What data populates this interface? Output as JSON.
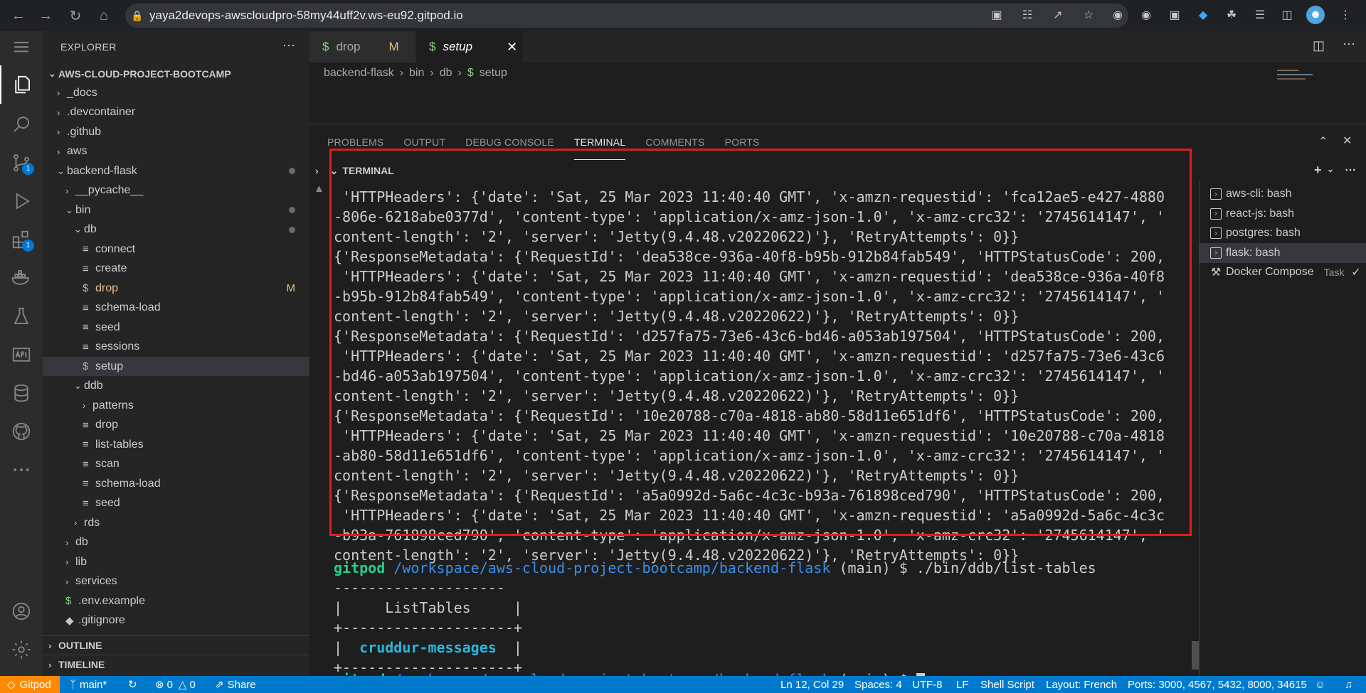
{
  "browser": {
    "url": "yaya2devops-awscloudpro-58my44uff2v.ws-eu92.gitpod.io"
  },
  "explorer": {
    "title": "EXPLORER",
    "root": "AWS-CLOUD-PROJECT-BOOTCAMP",
    "items": [
      {
        "label": "_docs",
        "depth": 1,
        "type": "folder",
        "open": false
      },
      {
        "label": ".devcontainer",
        "depth": 1,
        "type": "folder",
        "open": false
      },
      {
        "label": ".github",
        "depth": 1,
        "type": "folder",
        "open": false
      },
      {
        "label": "aws",
        "depth": 1,
        "type": "folder",
        "open": false
      },
      {
        "label": "backend-flask",
        "depth": 1,
        "type": "folder",
        "open": true,
        "dot": true
      },
      {
        "label": "__pycache__",
        "depth": 2,
        "type": "folder",
        "open": false
      },
      {
        "label": "bin",
        "depth": 2,
        "type": "folder",
        "open": true,
        "dot": true
      },
      {
        "label": "db",
        "depth": 3,
        "type": "folder",
        "open": true,
        "dot": true
      },
      {
        "label": "connect",
        "depth": 4,
        "type": "file"
      },
      {
        "label": "create",
        "depth": 4,
        "type": "file"
      },
      {
        "label": "drop",
        "depth": 4,
        "type": "shell",
        "modified": "M"
      },
      {
        "label": "schema-load",
        "depth": 4,
        "type": "file"
      },
      {
        "label": "seed",
        "depth": 4,
        "type": "file"
      },
      {
        "label": "sessions",
        "depth": 4,
        "type": "file"
      },
      {
        "label": "setup",
        "depth": 4,
        "type": "shell",
        "selected": true
      },
      {
        "label": "ddb",
        "depth": 3,
        "type": "folder",
        "open": true
      },
      {
        "label": "patterns",
        "depth": 4,
        "type": "folder",
        "open": false
      },
      {
        "label": "drop",
        "depth": 4,
        "type": "file"
      },
      {
        "label": "list-tables",
        "depth": 4,
        "type": "file"
      },
      {
        "label": "scan",
        "depth": 4,
        "type": "file"
      },
      {
        "label": "schema-load",
        "depth": 4,
        "type": "file"
      },
      {
        "label": "seed",
        "depth": 4,
        "type": "file"
      },
      {
        "label": "rds",
        "depth": 3,
        "type": "folder",
        "open": false
      },
      {
        "label": "db",
        "depth": 2,
        "type": "folder",
        "open": false
      },
      {
        "label": "lib",
        "depth": 2,
        "type": "folder",
        "open": false
      },
      {
        "label": "services",
        "depth": 2,
        "type": "folder",
        "open": false
      },
      {
        "label": ".env.example",
        "depth": 2,
        "type": "shell"
      },
      {
        "label": ".gitignore",
        "depth": 2,
        "type": "git"
      }
    ],
    "outline": "OUTLINE",
    "timeline": "TIMELINE"
  },
  "tabs": [
    {
      "label": "drop",
      "flag": "M"
    },
    {
      "label": "setup",
      "active": true
    }
  ],
  "breadcrumb": [
    "backend-flask",
    "bin",
    "db",
    "setup"
  ],
  "panel": {
    "tabs": [
      "PROBLEMS",
      "OUTPUT",
      "DEBUG CONSOLE",
      "TERMINAL",
      "COMMENTS",
      "PORTS"
    ],
    "active_tab": "TERMINAL",
    "section": "TERMINAL"
  },
  "terminal_lines": [
    " 'HTTPHeaders': {'date': 'Sat, 25 Mar 2023 11:40:40 GMT', 'x-amzn-requestid': 'fca12ae5-e427-4880",
    "-806e-6218abe0377d', 'content-type': 'application/x-amz-json-1.0', 'x-amz-crc32': '2745614147', '",
    "content-length': '2', 'server': 'Jetty(9.4.48.v20220622)'}, 'RetryAttempts': 0}}",
    "{'ResponseMetadata': {'RequestId': 'dea538ce-936a-40f8-b95b-912b84fab549', 'HTTPStatusCode': 200,",
    " 'HTTPHeaders': {'date': 'Sat, 25 Mar 2023 11:40:40 GMT', 'x-amzn-requestid': 'dea538ce-936a-40f8",
    "-b95b-912b84fab549', 'content-type': 'application/x-amz-json-1.0', 'x-amz-crc32': '2745614147', '",
    "content-length': '2', 'server': 'Jetty(9.4.48.v20220622)'}, 'RetryAttempts': 0}}",
    "{'ResponseMetadata': {'RequestId': 'd257fa75-73e6-43c6-bd46-a053ab197504', 'HTTPStatusCode': 200,",
    " 'HTTPHeaders': {'date': 'Sat, 25 Mar 2023 11:40:40 GMT', 'x-amzn-requestid': 'd257fa75-73e6-43c6",
    "-bd46-a053ab197504', 'content-type': 'application/x-amz-json-1.0', 'x-amz-crc32': '2745614147', '",
    "content-length': '2', 'server': 'Jetty(9.4.48.v20220622)'}, 'RetryAttempts': 0}}",
    "{'ResponseMetadata': {'RequestId': '10e20788-c70a-4818-ab80-58d11e651df6', 'HTTPStatusCode': 200,",
    " 'HTTPHeaders': {'date': 'Sat, 25 Mar 2023 11:40:40 GMT', 'x-amzn-requestid': '10e20788-c70a-4818",
    "-ab80-58d11e651df6', 'content-type': 'application/x-amz-json-1.0', 'x-amz-crc32': '2745614147', '",
    "content-length': '2', 'server': 'Jetty(9.4.48.v20220622)'}, 'RetryAttempts': 0}}",
    "{'ResponseMetadata': {'RequestId': 'a5a0992d-5a6c-4c3c-b93a-761898ced790', 'HTTPStatusCode': 200,",
    " 'HTTPHeaders': {'date': 'Sat, 25 Mar 2023 11:40:40 GMT', 'x-amzn-requestid': 'a5a0992d-5a6c-4c3c",
    "-b93a-761898ced790', 'content-type': 'application/x-amz-json-1.0', 'x-amz-crc32': '2745614147', '",
    "content-length': '2', 'server': 'Jetty(9.4.48.v20220622)'}, 'RetryAttempts': 0}}"
  ],
  "prompt": {
    "user": "gitpod",
    "path": "/workspace/aws-cloud-project-bootcamp/backend-flask",
    "branch": "(main)",
    "symbol": "$",
    "command": "./bin/ddb/list-tables"
  },
  "table": {
    "border": "+--------------------+",
    "top_border": "--------------------",
    "header": "|     ListTables     |",
    "row_prefix": "|  ",
    "row_value": "cruddur-messages",
    "row_suffix": "  |"
  },
  "terminal_list": [
    {
      "label": "aws-cli: bash"
    },
    {
      "label": "react-js: bash"
    },
    {
      "label": "postgres: bash"
    },
    {
      "label": "flask: bash",
      "selected": true
    },
    {
      "label": "Docker Compose",
      "suffix": "Task"
    }
  ],
  "statusbar": {
    "gitpod": "Gitpod",
    "branch": "main*",
    "errors": "0",
    "warnings": "0",
    "share": "Share",
    "position": "Ln 12, Col 29",
    "spaces": "Spaces: 4",
    "encoding": "UTF-8",
    "eol": "LF",
    "language": "Shell Script",
    "layout": "Layout: French",
    "ports": "Ports: 3000, 4567, 5432, 8000, 34615"
  },
  "colors": {
    "statusbar": "#007acc",
    "gitpod": "#ff8a00",
    "highlight_border": "#e01b24",
    "prompt_user": "#23d18b",
    "prompt_path": "#3b8eea"
  }
}
